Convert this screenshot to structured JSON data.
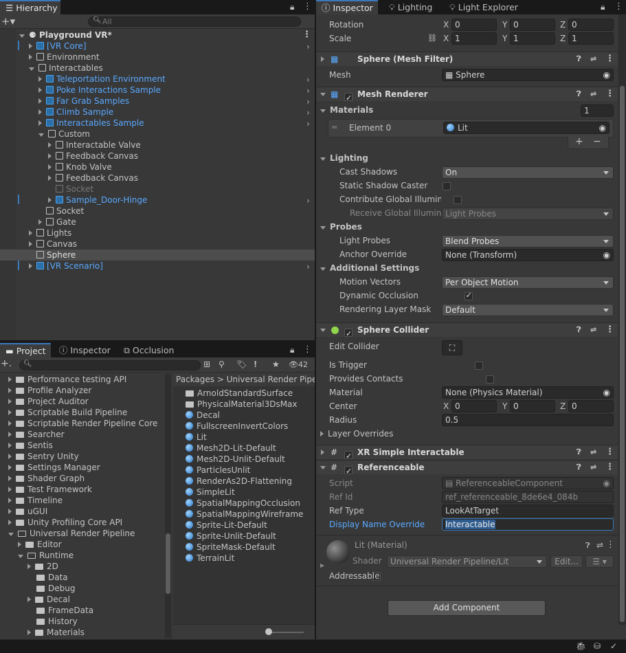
{
  "hierarchy": {
    "tab": "Hierarchy",
    "search_placeholder": "All",
    "scene": "Playground VR*",
    "rows": [
      "[VR Core]",
      "Environment",
      "Interactables",
      "Teleportation Environment",
      "Poke Interactions Sample",
      "Far Grab Samples",
      "Climb Sample",
      "Interactables Sample",
      "Custom",
      "Interactable Valve",
      "Feedback Canvas",
      "Knob Valve",
      "Feedback Canvas",
      "Socket",
      "Sample_Door-Hinge",
      "Socket",
      "Gate",
      "Lights",
      "Canvas",
      "Sphere",
      "[VR Scenario]"
    ]
  },
  "bottom_tabs": [
    "Project",
    "Inspector",
    "Occlusion"
  ],
  "project": {
    "count": "42",
    "breadcrumb_root": "Packages",
    "breadcrumb_current": "Universal Render Pipeli",
    "tree": [
      "Performance testing API",
      "Profile Analyzer",
      "Project Auditor",
      "Scriptable Build Pipeline",
      "Scriptable Render Pipeline Core",
      "Searcher",
      "Sentis",
      "Sentry Unity",
      "Settings Manager",
      "Shader Graph",
      "Test Framework",
      "Timeline",
      "uGUI",
      "Unity Profiling Core API",
      "Universal Render Pipeline",
      "Editor",
      "Runtime",
      "2D",
      "Data",
      "Debug",
      "Decal",
      "FrameData",
      "History",
      "Materials"
    ],
    "files": [
      "ArnoldStandardSurface",
      "PhysicalMaterial3DsMax",
      "Decal",
      "FullscreenInvertColors",
      "Lit",
      "Mesh2D-Lit-Default",
      "Mesh2D-Unlit-Default",
      "ParticlesUnlit",
      "RenderAs2D-Flattening",
      "SimpleLit",
      "SpatialMappingOcclusion",
      "SpatialMappingWireframe",
      "Sprite-Lit-Default",
      "Sprite-Unlit-Default",
      "SpriteMask-Default",
      "TerrainLit"
    ]
  },
  "inspector_tabs": [
    "Inspector",
    "Lighting",
    "Light Explorer"
  ],
  "transform": {
    "rotation_label": "Rotation",
    "rx": "0",
    "ry": "0",
    "rz": "0",
    "scale_label": "Scale",
    "sx": "1",
    "sy": "1",
    "sz": "1",
    "x": "X",
    "y": "Y",
    "z": "Z"
  },
  "mesh_filter": {
    "title": "Sphere (Mesh Filter)",
    "mesh_label": "Mesh",
    "mesh": "Sphere"
  },
  "mesh_renderer": {
    "title": "Mesh Renderer",
    "materials_label": "Materials",
    "materials_count": "1",
    "element0": "Element 0",
    "element0_value": "Lit",
    "lighting_label": "Lighting",
    "cast_shadows_label": "Cast Shadows",
    "cast_shadows": "On",
    "static_shadow_label": "Static Shadow Caster",
    "contribute_gi_label": "Contribute Global Illuminat",
    "receive_gi_label": "Receive Global Illuminat",
    "receive_gi": "Light Probes",
    "probes_label": "Probes",
    "light_probes_label": "Light Probes",
    "light_probes": "Blend Probes",
    "anchor_label": "Anchor Override",
    "anchor": "None (Transform)",
    "additional_label": "Additional Settings",
    "motion_vectors_label": "Motion Vectors",
    "motion_vectors": "Per Object Motion",
    "dynamic_occlusion_label": "Dynamic Occlusion",
    "rendering_layer_label": "Rendering Layer Mask",
    "rendering_layer": "Default"
  },
  "sphere_collider": {
    "title": "Sphere Collider",
    "edit_label": "Edit Collider",
    "trigger_label": "Is Trigger",
    "contacts_label": "Provides Contacts",
    "material_label": "Material",
    "material": "None (Physics Material)",
    "center_label": "Center",
    "cx": "0",
    "cy": "0",
    "cz": "0",
    "radius_label": "Radius",
    "radius": "0.5",
    "layer_overrides": "Layer Overrides"
  },
  "xr": {
    "title": "XR Simple Interactable"
  },
  "referenceable": {
    "title": "Referenceable",
    "script_label": "Script",
    "script": "ReferenceableComponent",
    "refid_label": "Ref Id",
    "refid": "ref_referenceable_8de6e4_084b",
    "reftype_label": "Ref Type",
    "reftype": "LookAtTarget",
    "display_label": "Display Name Override",
    "display": "Interactable"
  },
  "material_block": {
    "title": "Lit (Material)",
    "shader_label": "Shader",
    "shader": "Universal Render Pipeline/Lit",
    "edit": "Edit..."
  },
  "addressable": "Addressable",
  "add_component": "Add Component",
  "colors": {
    "accent": "#3a79bb",
    "link": "#5aa9ff",
    "panel": "#383838"
  }
}
